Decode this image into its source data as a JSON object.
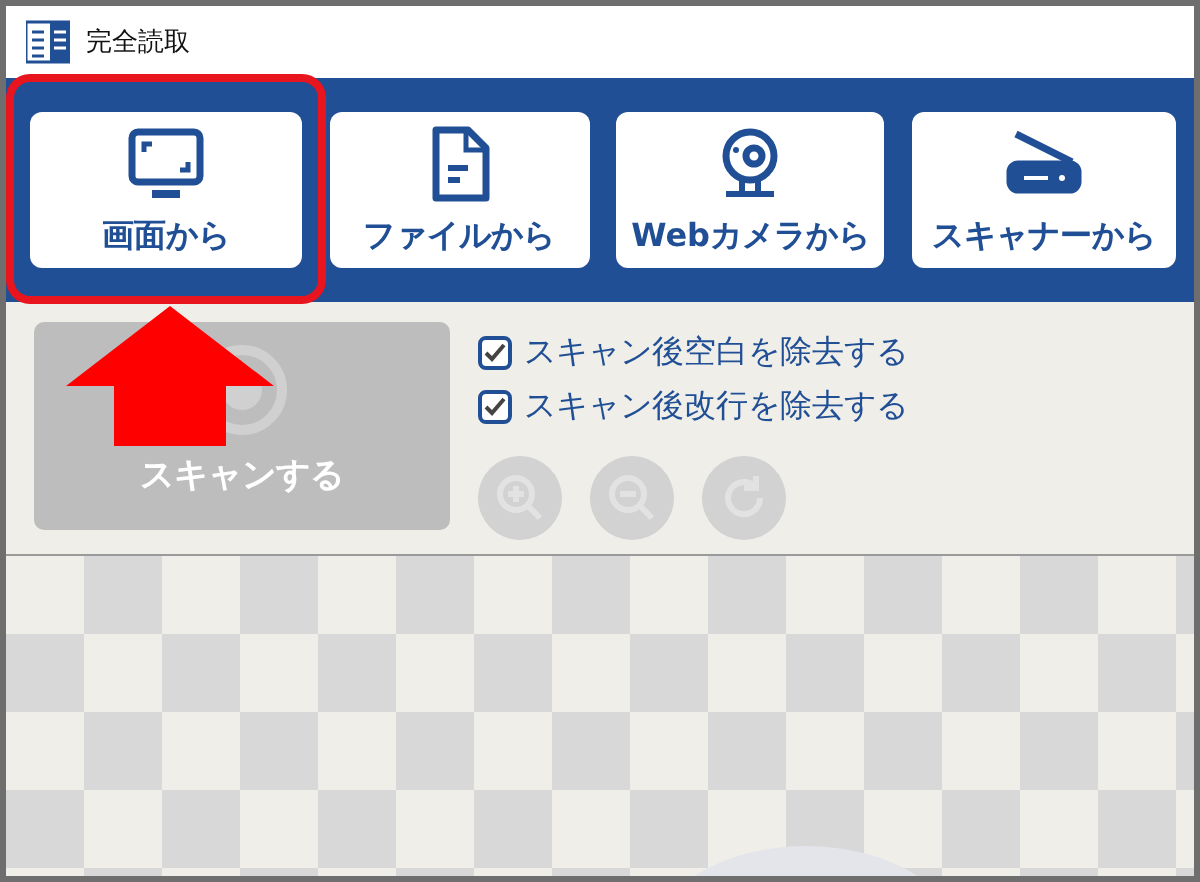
{
  "window": {
    "title": "完全読取"
  },
  "sources": [
    {
      "kind": "screen",
      "label": "画面から",
      "highlighted": true
    },
    {
      "kind": "file",
      "label": "ファイルから",
      "highlighted": false
    },
    {
      "kind": "webcam",
      "label": "Webカメラから",
      "highlighted": false
    },
    {
      "kind": "scanner",
      "label": "スキャナーから",
      "highlighted": false
    }
  ],
  "scan_button": {
    "label": "スキャンする",
    "disabled": true
  },
  "options": [
    {
      "label": "スキャン後空白を除去する",
      "checked": true
    },
    {
      "label": "スキャン後改行を除去する",
      "checked": true
    }
  ],
  "tools": [
    {
      "kind": "zoom-in",
      "disabled": true
    },
    {
      "kind": "zoom-out",
      "disabled": true
    },
    {
      "kind": "rotate",
      "disabled": true
    }
  ]
}
